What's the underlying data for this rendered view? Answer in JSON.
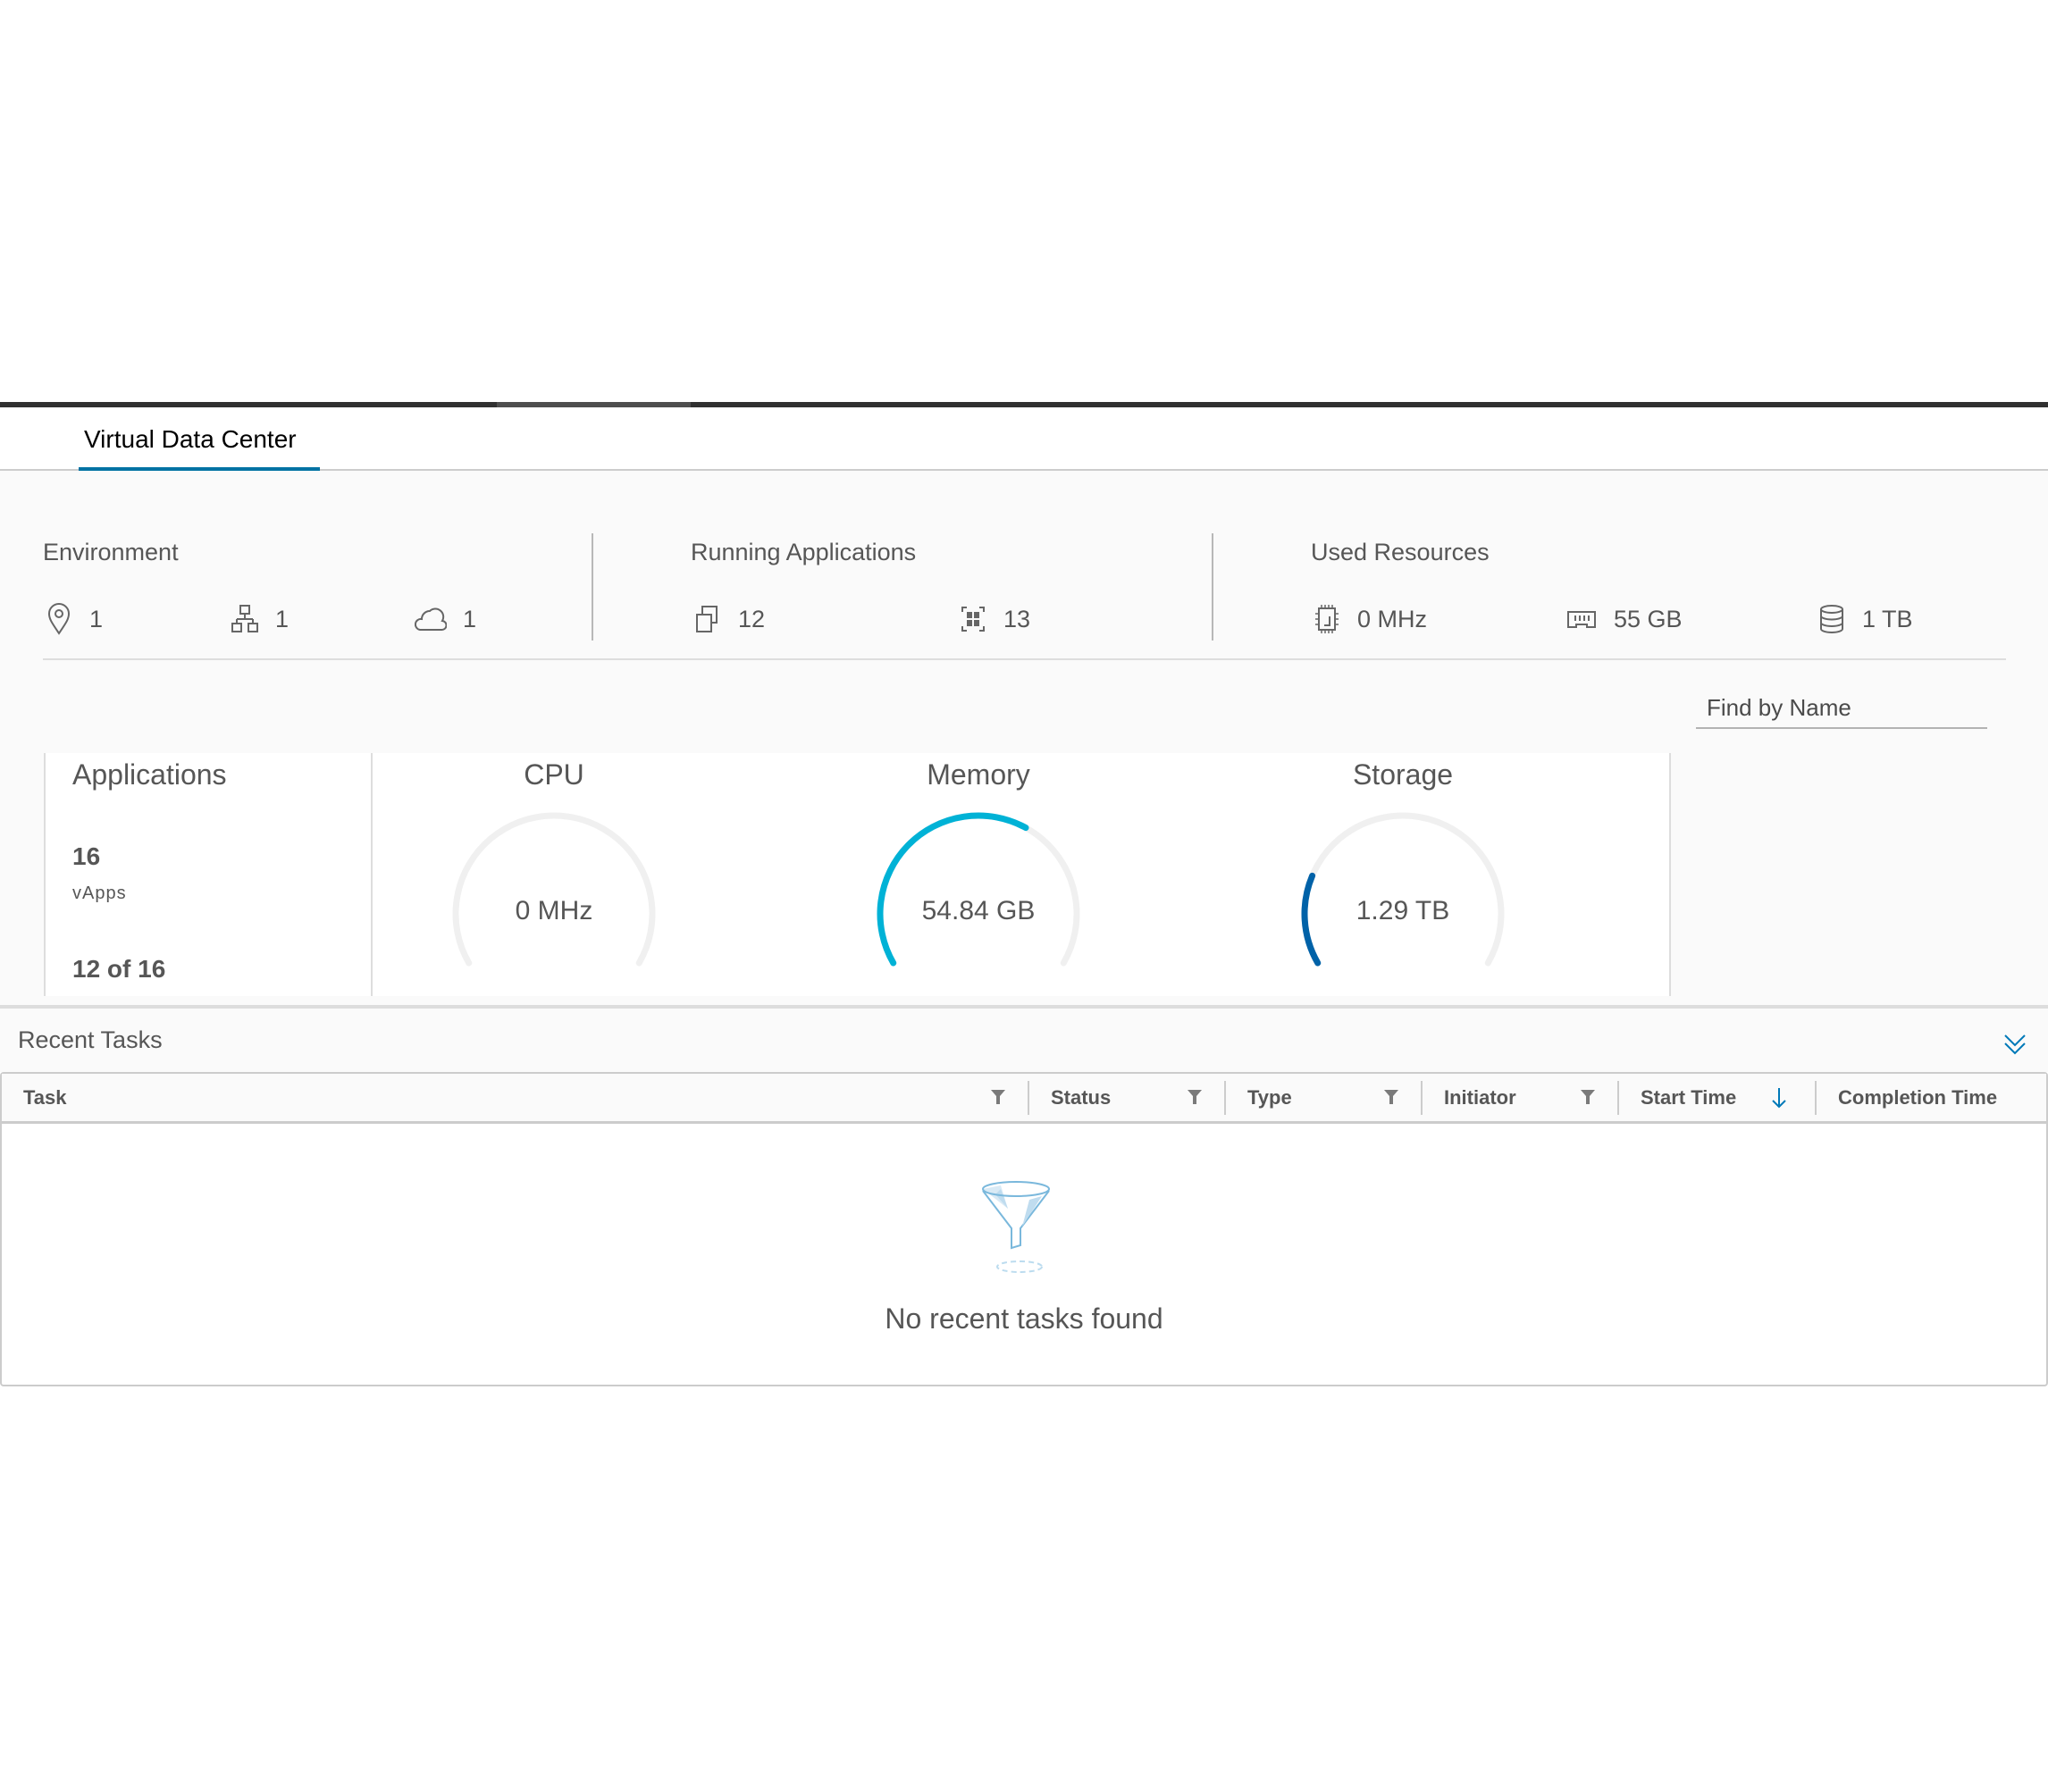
{
  "tabs": [
    {
      "label": "Virtual Data Center",
      "active": true
    }
  ],
  "summary": {
    "environment": {
      "title": "Environment",
      "stats": [
        {
          "icon": "location-pin-icon",
          "value": "1"
        },
        {
          "icon": "network-hierarchy-icon",
          "value": "1"
        },
        {
          "icon": "cloud-icon",
          "value": "1"
        }
      ]
    },
    "running_applications": {
      "title": "Running Applications",
      "stats": [
        {
          "icon": "vapp-icon",
          "value": "12"
        },
        {
          "icon": "vm-icon",
          "value": "13"
        }
      ]
    },
    "used_resources": {
      "title": "Used Resources",
      "stats": [
        {
          "icon": "cpu-icon",
          "value": "0 MHz"
        },
        {
          "icon": "memory-icon",
          "value": "55 GB"
        },
        {
          "icon": "storage-icon",
          "value": "1 TB"
        }
      ]
    }
  },
  "search": {
    "placeholder": "Find by Name",
    "value": ""
  },
  "applications_card": {
    "title": "Applications",
    "count": "16",
    "count_label": "vApps",
    "running": "12 of 16"
  },
  "gauges": [
    {
      "title": "CPU",
      "value": "0 MHz",
      "fill_fraction": 0.0,
      "color": "#00b5d6"
    },
    {
      "title": "Memory",
      "value": "54.84 GB",
      "fill_fraction": 0.62,
      "color": "#00b2d6"
    },
    {
      "title": "Storage",
      "value": "1.29 TB",
      "fill_fraction": 0.22,
      "color": "#0062a8"
    }
  ],
  "recent_tasks": {
    "title": "Recent Tasks",
    "columns": [
      {
        "label": "Task",
        "filter": true
      },
      {
        "label": "Status",
        "filter": true
      },
      {
        "label": "Type",
        "filter": true
      },
      {
        "label": "Initiator",
        "filter": true
      },
      {
        "label": "Start Time",
        "sort": "descending"
      },
      {
        "label": "Completion Time"
      }
    ],
    "rows": [],
    "empty_message": "No recent tasks found"
  },
  "colors": {
    "accent": "#0072a3",
    "track": "#f0f0f0",
    "text": "#565656"
  }
}
